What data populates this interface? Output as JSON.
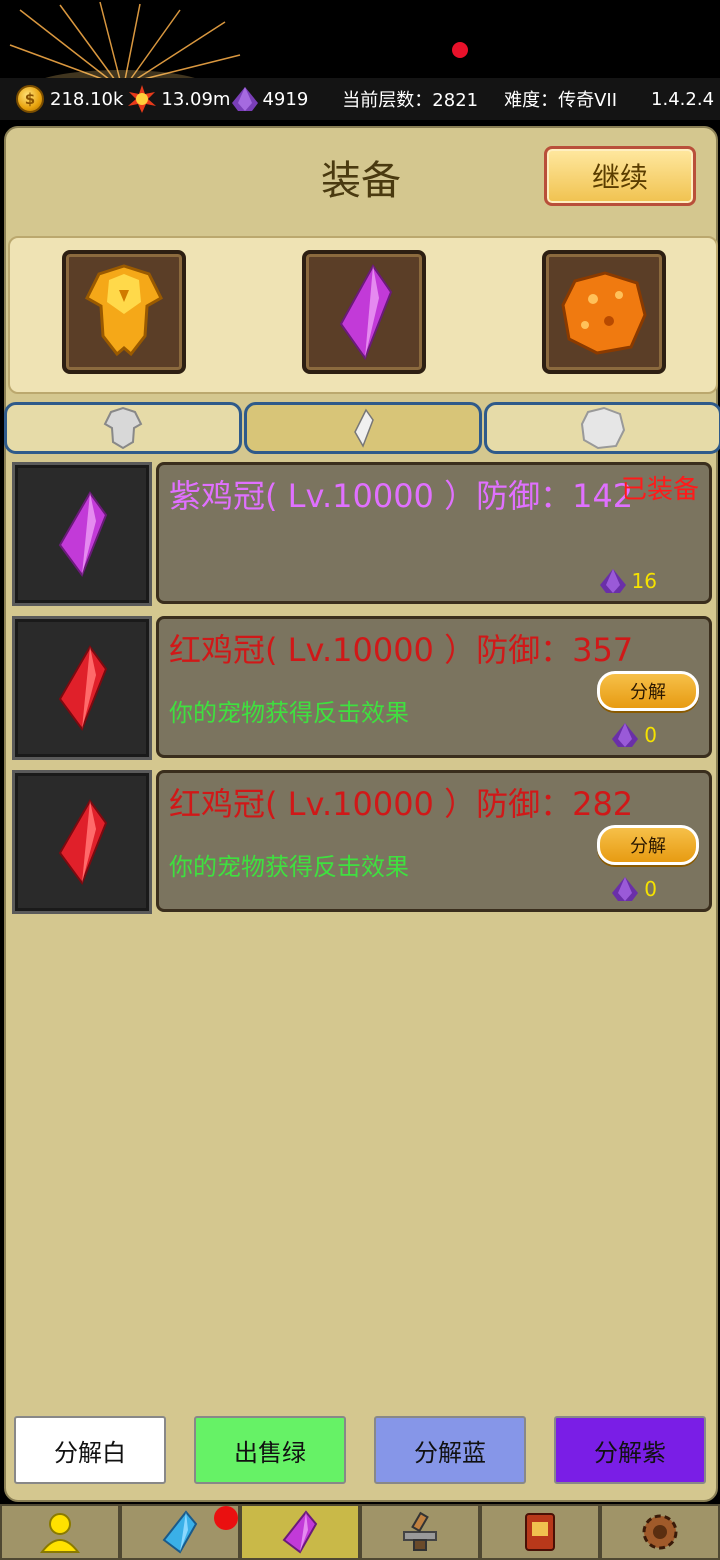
{
  "statusbar": {
    "gold": "218.10k",
    "fire": "13.09m",
    "gems": "4919",
    "floor_label": "当前层数：2821",
    "difficulty_label": "难度：传奇VII",
    "version": "1.4.2.4"
  },
  "panel": {
    "title": "装备",
    "continue_label": "继续"
  },
  "items": [
    {
      "name": "紫鸡冠( Lv.10000 ）防御：142",
      "equipped": "已装备",
      "effect": "",
      "decompose": "",
      "price": "16",
      "color": "#e070ff",
      "gem": "purple"
    },
    {
      "name": "红鸡冠( Lv.10000 ）防御：357",
      "equipped": "",
      "effect": "你的宠物获得反击效果",
      "decompose": "分解",
      "price": "0",
      "color": "#d01818",
      "gem": "red"
    },
    {
      "name": "红鸡冠( Lv.10000 ）防御：282",
      "equipped": "",
      "effect": "你的宠物获得反击效果",
      "decompose": "分解",
      "price": "0",
      "color": "#d01818",
      "gem": "red"
    }
  ],
  "bottom_buttons": {
    "white": "分解白",
    "green": "出售绿",
    "blue": "分解蓝",
    "purple": "分解紫"
  },
  "colors": {
    "panel_bg": "#d4c78f",
    "btn_white": "#ffffff",
    "btn_green": "#66f266",
    "btn_blue": "#8696e8",
    "btn_purple": "#7a1ee6"
  },
  "nav": [
    "character-icon",
    "blue-gem-icon",
    "purple-gem-icon",
    "anvil-icon",
    "book-icon",
    "gear-icon"
  ]
}
